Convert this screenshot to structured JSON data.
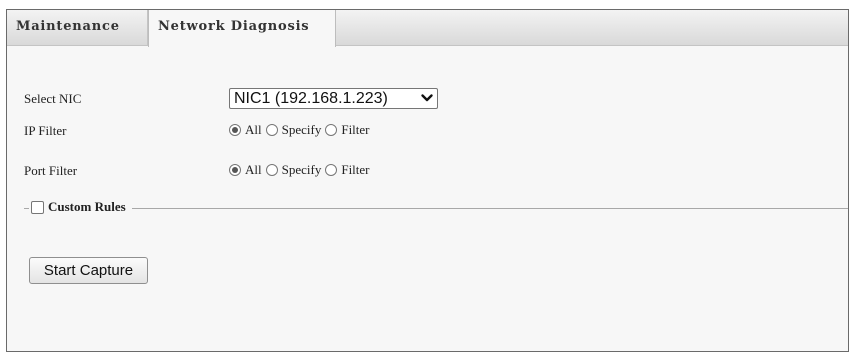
{
  "tabs": [
    {
      "label": "Maintenance",
      "active": false
    },
    {
      "label": "Network Diagnosis",
      "active": true
    }
  ],
  "form": {
    "nic": {
      "label": "Select NIC",
      "selected": "NIC1 (192.168.1.223)"
    },
    "ip_filter": {
      "label": "IP Filter",
      "options": [
        "All",
        "Specify",
        "Filter"
      ],
      "selected": "All"
    },
    "port_filter": {
      "label": "Port Filter",
      "options": [
        "All",
        "Specify",
        "Filter"
      ],
      "selected": "All"
    },
    "custom_rules": {
      "label": "Custom Rules",
      "checked": false
    }
  },
  "actions": {
    "start_capture": "Start Capture"
  },
  "icons": {
    "select_arrow": "chevron-down-icon"
  },
  "colors": {
    "panel_bg": "#f7f7f7",
    "tabbar_bg": "#d9d9d9",
    "border": "#6a6a6a"
  }
}
